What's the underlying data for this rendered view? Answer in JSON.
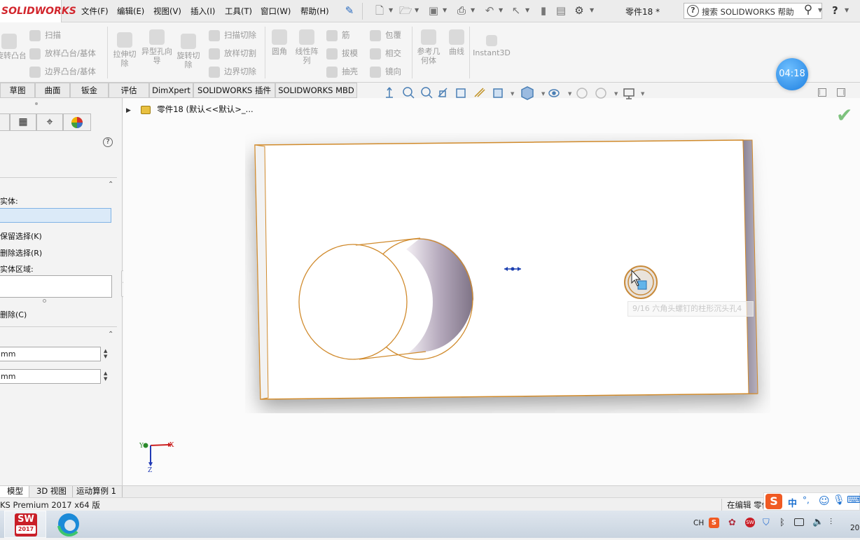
{
  "app": {
    "logo_text": "SOLIDWORKS",
    "doc_title": "零件18 *",
    "help_search_placeholder": "搜索 SOLIDWORKS 帮助",
    "help_btn": "?"
  },
  "menus": [
    "文件(F)",
    "编辑(E)",
    "视图(V)",
    "插入(I)",
    "工具(T)",
    "窗口(W)",
    "帮助(H)"
  ],
  "command_manager": {
    "revolve_boss": "旋转凸台/基体",
    "sweep": "扫描",
    "loft_boss": "放样凸台/基体",
    "boundary_boss": "边界凸台/基体",
    "extruded_cut": "拉伸切除",
    "hole_wizard": "异型孔向导",
    "revolved_cut": "旋转切除",
    "swept_cut": "扫描切除",
    "lofted_cut": "放样切割",
    "boundary_cut": "边界切除",
    "fillet": "圆角",
    "linear_pattern": "线性阵列",
    "rib": "筋",
    "draft": "拔模",
    "shell": "抽壳",
    "wrap": "包覆",
    "intersect": "相交",
    "mirror": "镜向",
    "ref_geometry": "参考几何体",
    "curves": "曲线",
    "instant3d": "Instant3D"
  },
  "tabs": [
    "草图",
    "曲面",
    "钣金",
    "评估",
    "DimXpert",
    "SOLIDWORKS 插件",
    "SOLIDWORKS MBD"
  ],
  "timer": "04:18",
  "feature_tree": {
    "root_label": "零件18 (默认<<默认>_..."
  },
  "property_manager": {
    "help_icon": "?",
    "section1": {
      "bodies_label": "实体:",
      "keep_selections": "保留选择(K)",
      "remove_selections": "删除选择(R)",
      "body_region_label": "实体区域:",
      "remove_button": "删除(C)"
    },
    "section2": {
      "field1_value": "mm",
      "field2_value": "mm"
    }
  },
  "viewport": {
    "tooltip": "9/16 六角头螺钉的柱形沉头孔4"
  },
  "triad": {
    "x": "X",
    "y": "Y",
    "z": "Z"
  },
  "bottom_tabs": [
    "模型",
    "3D 视图",
    "运动算例 1"
  ],
  "status": {
    "left_text": "KS Premium 2017 x64 版",
    "right_text": "在编辑 零件"
  },
  "ime": {
    "lang": "中",
    "punct": "°,"
  },
  "taskbar": {
    "sw_label": "SW",
    "sw_year": "2017",
    "tray_lang": "CH",
    "clock_partial": "20"
  }
}
